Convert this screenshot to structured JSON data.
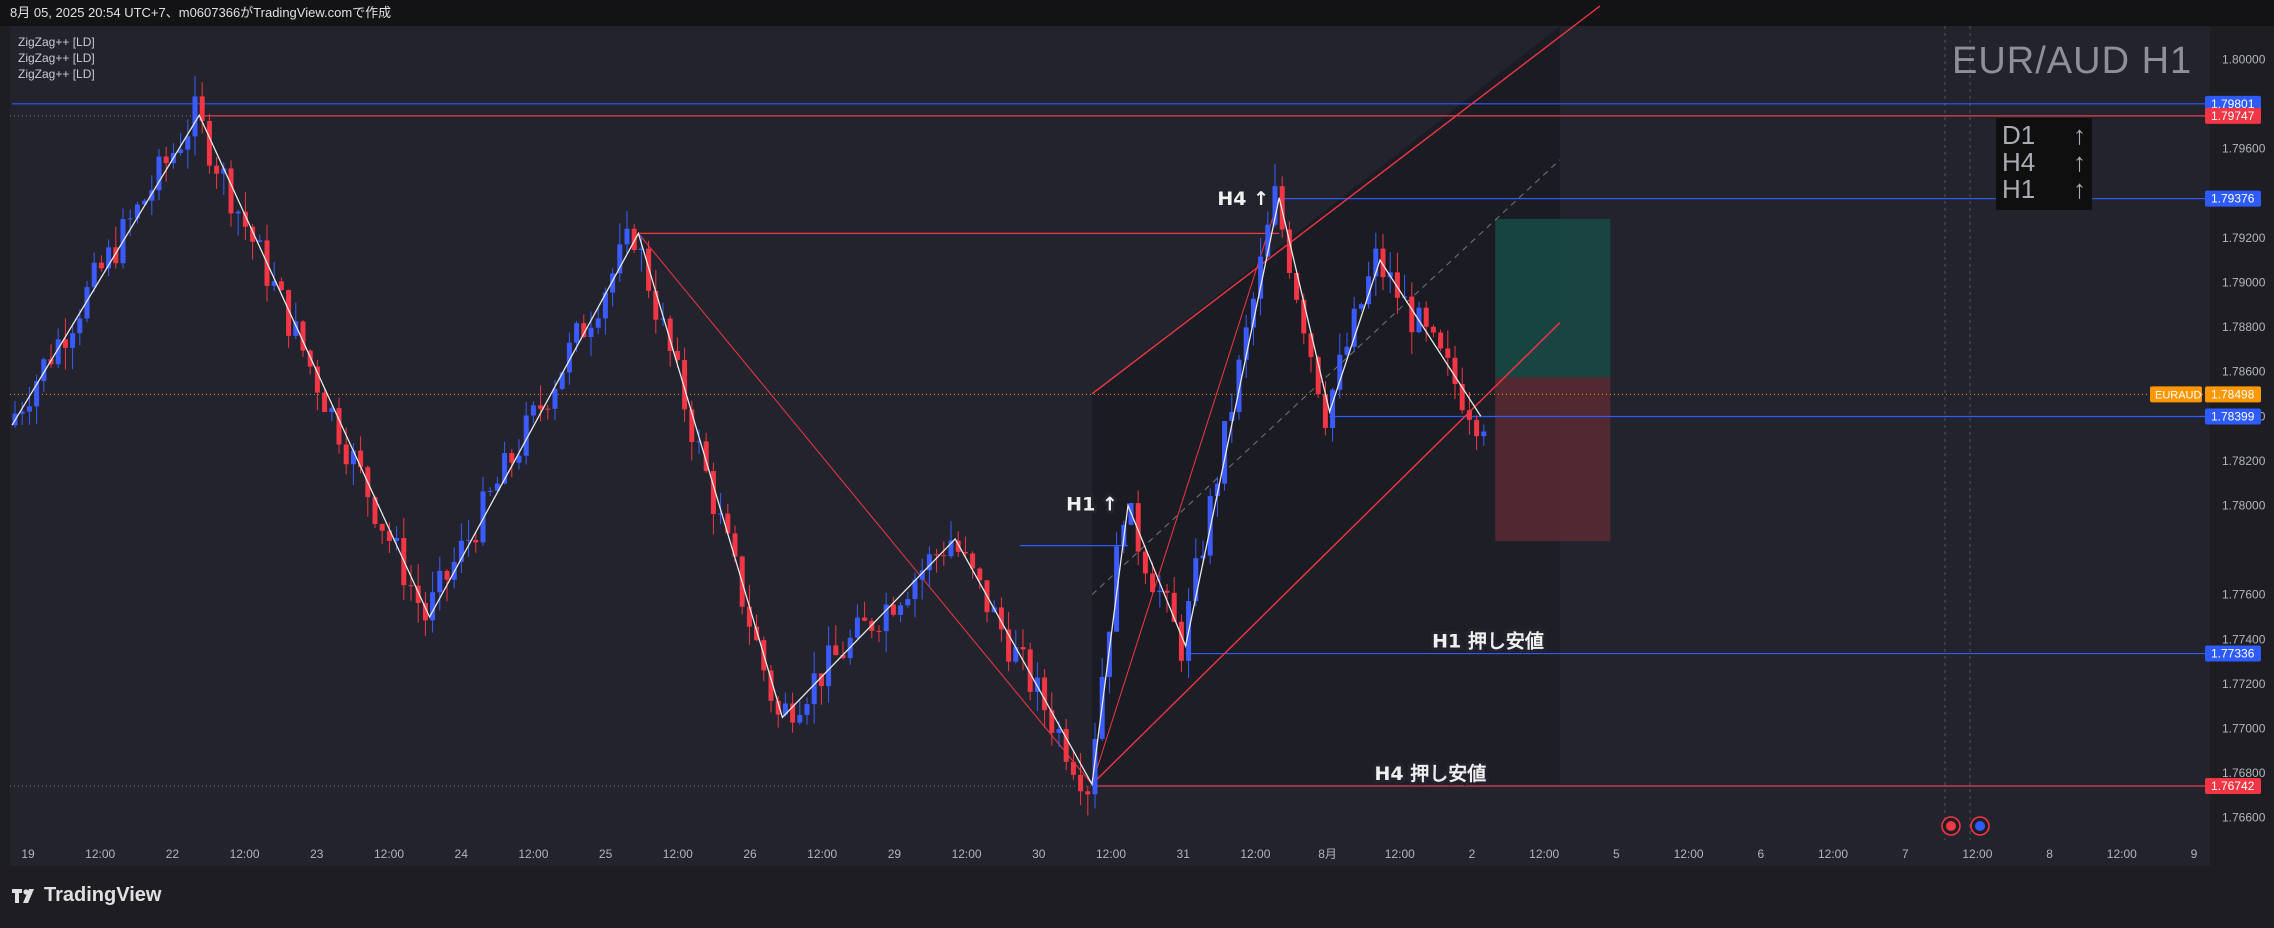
{
  "header": {
    "title": "8月 05, 2025 20:54 UTC+7、m0607366がTradingView.comで作成"
  },
  "legend": {
    "items": [
      "ZigZag++ [LD]",
      "ZigZag++ [LD]",
      "ZigZag++ [LD]"
    ]
  },
  "symbol_title": "EUR/AUD H1",
  "timeframe_box": {
    "rows": [
      {
        "tf": "D1",
        "arrow": "↑"
      },
      {
        "tf": "H4",
        "arrow": "↑"
      },
      {
        "tf": "H1",
        "arrow": "↑"
      }
    ]
  },
  "footer": {
    "brand": "TradingView"
  },
  "colors": {
    "background": "#22232c",
    "bull": "#3b5bff",
    "bear": "#f23645",
    "zigzag": "#e8e8e8",
    "blue_line": "#2e5bff",
    "red_line": "#f23645",
    "tp_zone": "#184a45",
    "sl_zone": "#5a2a33",
    "current_price": "#ff9800"
  },
  "chart_data": {
    "type": "candlestick",
    "title": "EUR/AUD H1",
    "symbol": "EURAUD",
    "ylim": [
      1.765,
      1.8015
    ],
    "grid": false,
    "price_ticks": [
      "1.80000",
      "1.79600",
      "1.79200",
      "1.78800",
      "1.78400",
      "1.78000",
      "1.77600",
      "1.77200",
      "1.76800",
      "1.76600"
    ],
    "price_tick_values": [
      1.8,
      1.796,
      1.792,
      1.788,
      1.784,
      1.78,
      1.776,
      1.772,
      1.768,
      1.766
    ],
    "extra_ticks": [
      "1.78600",
      "1.78200",
      "1.77400",
      "1.77000",
      "1.79000"
    ],
    "extra_tick_values": [
      1.786,
      1.782,
      1.774,
      1.77,
      1.79
    ],
    "time_labels": [
      "19",
      "12:00",
      "22",
      "12:00",
      "23",
      "12:00",
      "24",
      "12:00",
      "25",
      "12:00",
      "26",
      "12:00",
      "29",
      "12:00",
      "30",
      "12:00",
      "31",
      "12:00",
      "8月",
      "12:00",
      "2",
      "12:00",
      "5",
      "12:00",
      "6",
      "12:00",
      "7",
      "12:00",
      "8",
      "12:00",
      "9"
    ],
    "price_labels": [
      {
        "text": "1.79801",
        "value": 1.79801,
        "color": "#2e5bff"
      },
      {
        "text": "1.79747",
        "value": 1.79747,
        "color": "#f23645"
      },
      {
        "text": "1.79376",
        "value": 1.79376,
        "color": "#2e5bff"
      },
      {
        "text": "1.78498",
        "value": 1.78498,
        "color": "#ff9800"
      },
      {
        "text": "1.78399",
        "value": 1.78399,
        "color": "#2e5bff"
      },
      {
        "text": "1.77336",
        "value": 1.77336,
        "color": "#2e5bff"
      },
      {
        "text": "1.76742",
        "value": 1.76742,
        "color": "#f23645"
      }
    ],
    "current_price_tag": "EURAUD",
    "zigzag_points": [
      [
        0,
        1.7836
      ],
      [
        26,
        1.7975
      ],
      [
        58,
        1.775
      ],
      [
        87,
        1.7922
      ],
      [
        107,
        1.7705
      ],
      [
        131,
        1.7785
      ],
      [
        150,
        1.7675
      ],
      [
        155,
        1.78
      ],
      [
        163,
        1.7737
      ],
      [
        176,
        1.7938
      ],
      [
        183,
        1.7842
      ],
      [
        190,
        1.791
      ],
      [
        204,
        1.784
      ]
    ],
    "h1_zigzag_points": [
      [
        176,
        1.7938
      ],
      [
        183,
        1.7842
      ],
      [
        190,
        1.791
      ],
      [
        204,
        1.784
      ]
    ],
    "annotations": [
      {
        "text": "H4 ↑",
        "x": 171,
        "y": 1.7932
      },
      {
        "text": "H1 ↑",
        "x": 150,
        "y": 1.7795
      },
      {
        "text": "H1 押し安値",
        "x": 205,
        "y": 1.77336
      },
      {
        "text": "H4 押し安値",
        "x": 197,
        "y": 1.76742
      }
    ],
    "horizontal_levels": [
      {
        "value": 1.79801,
        "color": "#2e5bff",
        "from": 0
      },
      {
        "value": 1.79747,
        "color": "#f23645",
        "from": 26
      },
      {
        "value": 1.79376,
        "color": "#2e5bff",
        "from": 176
      },
      {
        "value": 1.78399,
        "color": "#2e5bff",
        "from": 183
      },
      {
        "value": 1.77336,
        "color": "#2e5bff",
        "from": 163
      },
      {
        "value": 1.76742,
        "color": "#f23645",
        "from": 150
      },
      {
        "value": 1.7922,
        "color": "#f23645",
        "from": 87,
        "to": 176
      },
      {
        "value": 1.7782,
        "color": "#2e5bff",
        "from": 140,
        "to": 155
      }
    ],
    "channel": {
      "x0": 150,
      "x1": 215,
      "upper0": 1.785,
      "upper1": 1.8015,
      "lower0": 1.7675,
      "lower1": 1.7882
    },
    "trade_box": {
      "x0": 206,
      "x1": 222,
      "entry": 1.78575,
      "tp": 1.79285,
      "sl": 1.7784
    },
    "candles_count": 205
  }
}
